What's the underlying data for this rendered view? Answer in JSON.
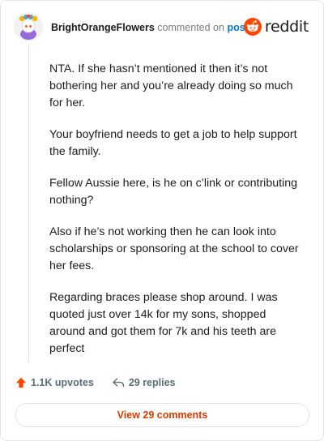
{
  "comment": {
    "username": "BrightOrangeFlowers",
    "verb": "commented on",
    "target": "post",
    "paragraphs": [
      "NTA. If she hasn’t mentioned it then it’s not bothering her and you’re already doing so much for her.",
      "Your boyfriend needs to get a job to help support the family.",
      "Fellow Aussie here, is he on c’link or contributing nothing?",
      "Also if he’s not working then he can look into scholarships or sponsoring at the school to cover her fees.",
      "Regarding braces please shop around. I was quoted just over 14k for my sons, shopped around and got them for 7k and his teeth are perfect"
    ]
  },
  "brand": {
    "wordmark": "reddit",
    "color": "#ff4500"
  },
  "actions": {
    "upvotes": "1.1K upvotes",
    "replies": "29 replies"
  },
  "view_comments_label": "View 29 comments",
  "icons": {
    "avatar": "snoo-avatar-icon",
    "logo": "reddit-snoo-icon",
    "upvote": "upvote-arrow-icon",
    "reply": "reply-arrow-icon"
  },
  "colors": {
    "upvote": "#ff4500",
    "link": "#0079d3",
    "view_comments": "#d93a00"
  }
}
